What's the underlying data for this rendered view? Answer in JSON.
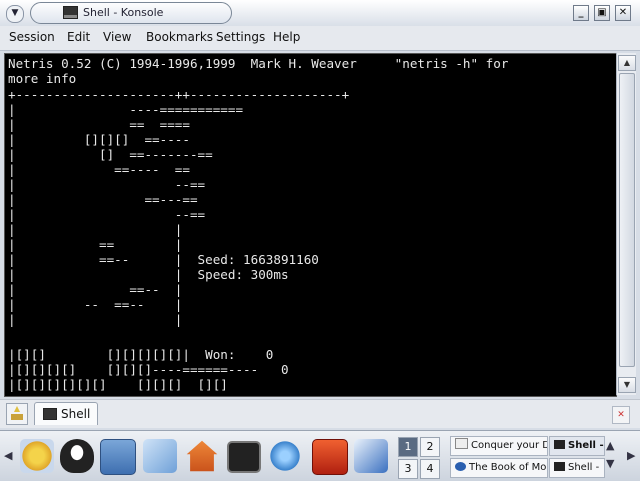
{
  "window": {
    "title": "Shell - Konsole"
  },
  "menu": [
    "Session",
    "Edit",
    "View",
    "Bookmarks",
    "Settings",
    "Help"
  ],
  "terminal": {
    "lines": [
      "Netris 0.52 (C) 1994-1996,1999  Mark H. Weaver     \"netris -h\" for",
      "more info",
      "+---------------------++--------------------+",
      "|               ----===========",
      "|               ==  ====",
      "|         [][][]  ==----",
      "|           []  ==-------==",
      "|             ==----  ==",
      "|                     --==",
      "|                 ==---==",
      "|                     --==",
      "|                     |",
      "|           ==        |",
      "|           ==--      |  Seed: 1663891160",
      "|                     |  Speed: 300ms",
      "|               ==--  |",
      "|         --  ==--    |",
      "|                     |",
      "|[][]        [][][][][]|  Won:    0",
      "|[][][][]    [][][]----======----   0",
      "|[][][][][][]    [][][]  [][]"
    ]
  },
  "tabs": {
    "items": [
      {
        "label": "Shell"
      }
    ]
  },
  "taskbar": {
    "desktops": [
      "1",
      "2",
      "3",
      "4"
    ],
    "tasks": [
      {
        "label": "Conquer your D",
        "state": "normal"
      },
      {
        "label": "Shell -",
        "state": "active"
      },
      {
        "label": "The Book of Mo",
        "state": "normal"
      },
      {
        "label": "Shell -",
        "state": "normal"
      }
    ]
  },
  "colors": {
    "terminal_bg": "#000000",
    "terminal_fg": "#e8e8e8",
    "block_blue": "#1a2fc8",
    "block_orange": "#c06a10",
    "block_red": "#d01818",
    "block_gray": "#c8c8c8"
  }
}
